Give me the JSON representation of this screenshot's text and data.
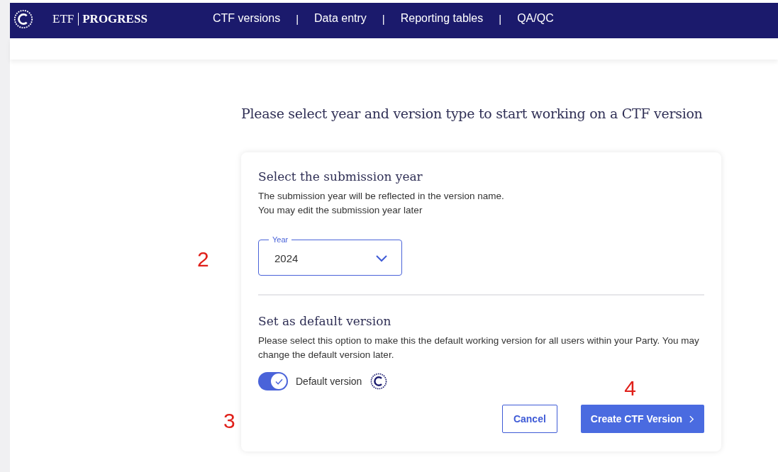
{
  "header": {
    "brand_left": "ETF",
    "brand_right": "PROGRESS",
    "nav": [
      {
        "label": "CTF versions",
        "selected": false
      },
      {
        "label": "Data entry",
        "selected": false
      },
      {
        "label": "Reporting tables",
        "selected": false
      },
      {
        "label": "QA/QC",
        "selected": false
      }
    ],
    "separator": "|"
  },
  "page_title": "Please select year and version type to start working on a CTF version",
  "year_section": {
    "title": "Select the submission year",
    "lines": [
      "The submission year will be reflected in the version name.",
      "You may edit the submission year later"
    ],
    "field": {
      "label": "Year",
      "value": "2024"
    }
  },
  "default_section": {
    "title": "Set as default version",
    "description": "Please select this option to make this the default working version for all users within your Party. You may change the default version later.",
    "toggle": {
      "label": "Default version",
      "on": true
    }
  },
  "buttons": [
    {
      "label": "Cancel",
      "kind": "secondary"
    },
    {
      "label": "Create CTF Version",
      "kind": "primary"
    }
  ],
  "annotations": [
    "2",
    "3",
    "4"
  ]
}
